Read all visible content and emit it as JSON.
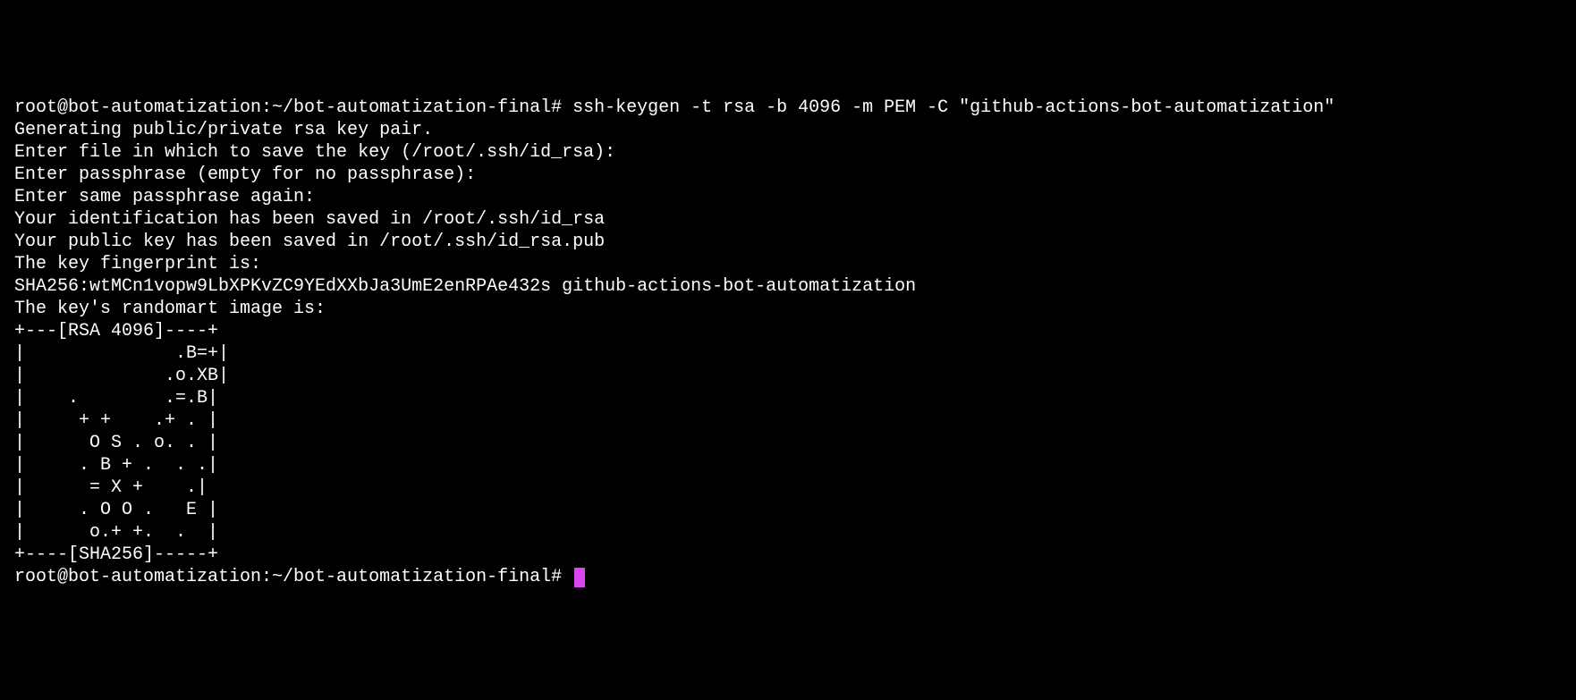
{
  "terminal": {
    "lines": [
      "root@bot-automatization:~/bot-automatization-final# ssh-keygen -t rsa -b 4096 -m PEM -C \"github-actions-bot-automatization\"",
      "Generating public/private rsa key pair.",
      "Enter file in which to save the key (/root/.ssh/id_rsa):",
      "Enter passphrase (empty for no passphrase):",
      "Enter same passphrase again:",
      "Your identification has been saved in /root/.ssh/id_rsa",
      "Your public key has been saved in /root/.ssh/id_rsa.pub",
      "The key fingerprint is:",
      "SHA256:wtMCn1vopw9LbXPKvZC9YEdXXbJa3UmE2enRPAe432s github-actions-bot-automatization",
      "The key's randomart image is:",
      "+---[RSA 4096]----+",
      "|              .B=+|",
      "|             .o.XB|",
      "|    .        .=.B|",
      "|     + +    .+ . |",
      "|      O S . o. . |",
      "|     . B + .  . .|",
      "|      = X +    .|",
      "|     . O O .   E |",
      "|      o.+ +.  .  |",
      "+----[SHA256]-----+"
    ],
    "prompt": "root@bot-automatization:~/bot-automatization-final# "
  }
}
